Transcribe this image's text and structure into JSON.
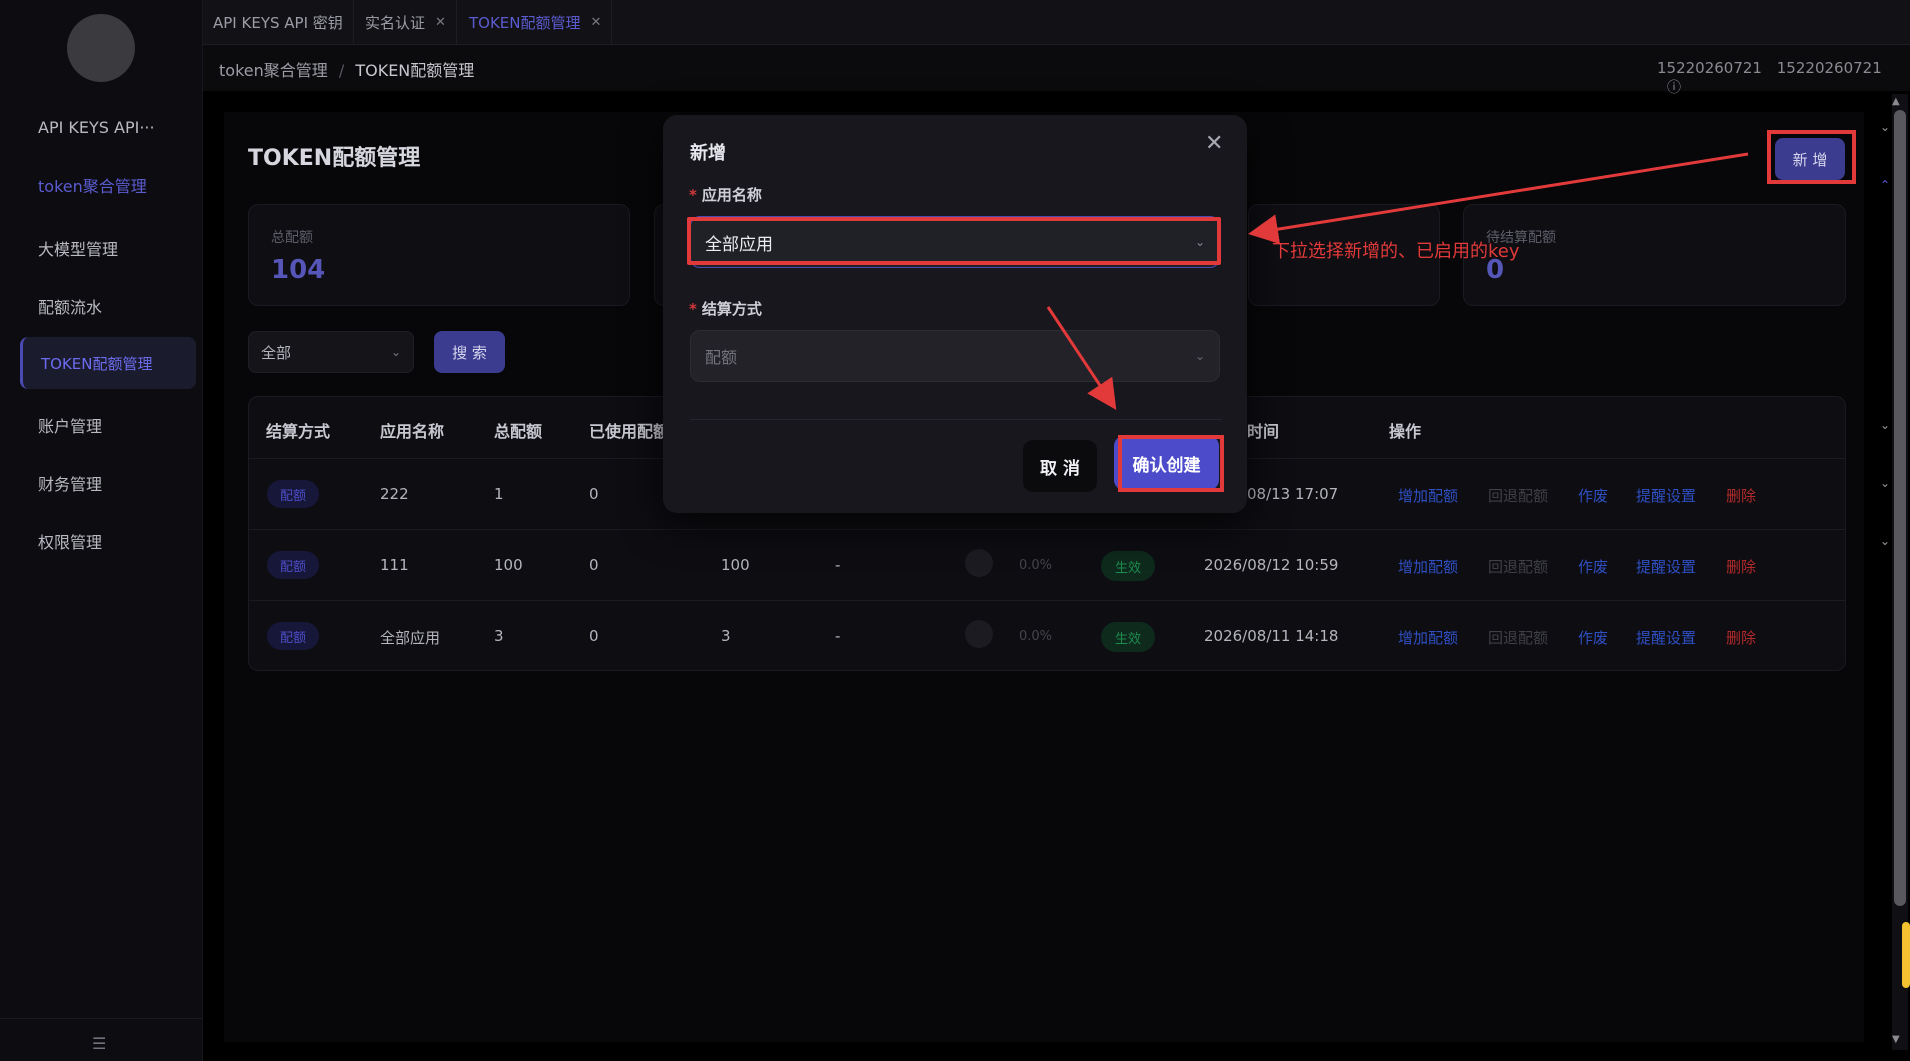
{
  "sidebar": {
    "items": [
      {
        "label": "API KEYS  API···"
      },
      {
        "label": "token聚合管理"
      },
      {
        "label": "大模型管理"
      },
      {
        "label": "配额流水"
      },
      {
        "label": "TOKEN配额管理"
      },
      {
        "label": "账户管理"
      },
      {
        "label": "财务管理"
      },
      {
        "label": "权限管理"
      }
    ]
  },
  "tabs": [
    {
      "label": "API KEYS  API 密钥"
    },
    {
      "label": "实名认证"
    },
    {
      "label": "TOKEN配额管理"
    }
  ],
  "breadcrumb": {
    "parent": "token聚合管理",
    "separator": "/",
    "current": "TOKEN配额管理"
  },
  "user": {
    "id1": "15220260721",
    "id2": "15220260721"
  },
  "page": {
    "title": "TOKEN配额管理",
    "add_label": "新 增"
  },
  "stats": [
    {
      "label": "总配额",
      "value": "104"
    },
    {
      "label": "待结算配额",
      "value": "0"
    }
  ],
  "filter": {
    "value": "全部",
    "search_label": "搜 索"
  },
  "table": {
    "headers": [
      "结算方式",
      "应用名称",
      "总配额",
      "已使用配额",
      "时间",
      "操作"
    ],
    "rows": [
      {
        "method": "配额",
        "app": "222",
        "total": "1",
        "used": "0",
        "remain": "",
        "dash": "",
        "pct": "",
        "status": "",
        "time": "08/13 17:07"
      },
      {
        "method": "配额",
        "app": "111",
        "total": "100",
        "used": "0",
        "remain": "100",
        "dash": "-",
        "pct": "0.0%",
        "status": "生效",
        "time": "2026/08/12 10:59"
      },
      {
        "method": "配额",
        "app": "全部应用",
        "total": "3",
        "used": "0",
        "remain": "3",
        "dash": "-",
        "pct": "0.0%",
        "status": "生效",
        "time": "2026/08/11 14:18"
      }
    ],
    "actions": [
      "增加配额",
      "回退配额",
      "作废",
      "提醒设置",
      "删除"
    ]
  },
  "modal": {
    "title": "新增",
    "app_label": "应用名称",
    "app_value": "全部应用",
    "settle_label": "结算方式",
    "settle_placeholder": "配额",
    "cancel_label": "取 消",
    "confirm_label": "确认创建",
    "required_mark": "*"
  },
  "annotation": {
    "text": "下拉选择新增的、已启用的key",
    "color": "#e23a3a"
  },
  "colors": {
    "accent": "#4c4ccb",
    "highlight": "#e23a3a",
    "status_green": "#1d8b4d"
  }
}
